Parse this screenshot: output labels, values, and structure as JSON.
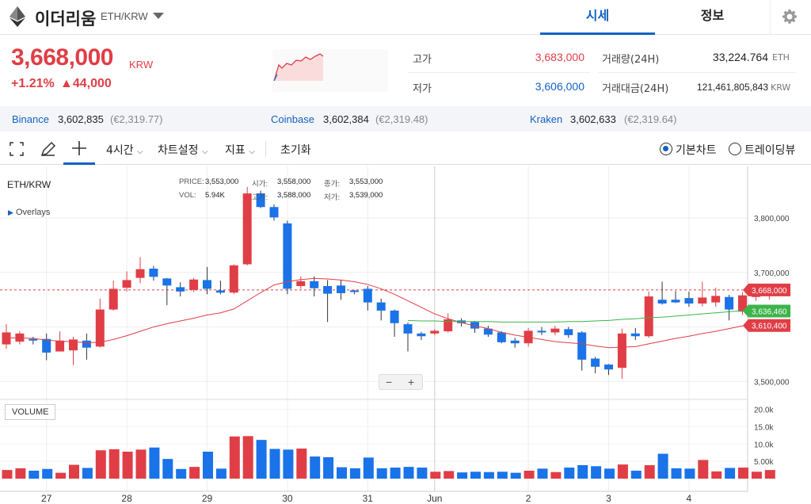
{
  "header": {
    "coin_name": "이더리움",
    "pair": "ETH/KRW",
    "tabs": [
      {
        "label": "시세"
      },
      {
        "label": "정보"
      }
    ]
  },
  "ticker": {
    "price": "3,668,000",
    "unit": "KRW",
    "change_pct": "+1.21%",
    "change_abs": "▲44,000",
    "high_label": "고가",
    "high": "3,683,000",
    "low_label": "저가",
    "low": "3,606,000",
    "volume_label": "거래량(24H)",
    "volume": "33,224.764",
    "volume_unit": "ETH",
    "amount_label": "거래대금(24H)",
    "amount": "121,461,805,843",
    "amount_unit": "KRW"
  },
  "exchanges": [
    {
      "name": "Binance",
      "price": "3,602,835",
      "eur": "(€2,319.77)"
    },
    {
      "name": "Coinbase",
      "price": "3,602,384",
      "eur": "(€2,319.48)"
    },
    {
      "name": "Kraken",
      "price": "3,602,633",
      "eur": "(€2,319.64)"
    }
  ],
  "toolbar": {
    "interval": "4시간",
    "chart_settings": "차트설정",
    "indicators": "지표",
    "reset": "초기화",
    "basic_chart": "기본차트",
    "tradingview": "트레이딩뷰"
  },
  "legend": {
    "symbol": "ETH/KRW",
    "overlays": "Overlays",
    "price_label": "PRICE:",
    "price": "3,553,000",
    "open_label": "시가:",
    "open": "3,558,000",
    "close_label": "종가:",
    "close": "3,553,000",
    "vol_label": "VOL:",
    "vol": "5.94K",
    "high_label": "고가:",
    "high": "3,588,000",
    "low_label": "저가:",
    "low": "3,539,000"
  },
  "price_tags": [
    {
      "value": "3,668,000",
      "color": "#e03e46"
    },
    {
      "value": "3,636,460",
      "color": "#3cb44b"
    },
    {
      "value": "3,610,400",
      "color": "#e03e46"
    }
  ],
  "volume_label": "VOLUME",
  "colors": {
    "up": "#e03e46",
    "down": "#1a73e8",
    "accent": "#1261c4",
    "ma_short": "#e03e46",
    "ma_long": "#3cb44b"
  },
  "chart_data": {
    "type": "candlestick",
    "ylim": [
      3470000,
      3880000
    ],
    "y_ticks": [
      3500000,
      3600000,
      3700000,
      3800000
    ],
    "y_tick_labels": [
      "3,500,000",
      "3,600,000",
      "3,700,000",
      "3,800,000"
    ],
    "vol_ylim": [
      0,
      22000
    ],
    "vol_ticks": [
      5000,
      10000,
      15000,
      20000
    ],
    "vol_tick_labels": [
      "5.00k",
      "10.0k",
      "15.0k",
      "20.0k"
    ],
    "x_labels": [
      "27",
      "28",
      "29",
      "30",
      "31",
      "Jun",
      "2",
      "3",
      "4"
    ],
    "x_label_index": [
      3,
      9,
      15,
      21,
      27,
      32,
      39,
      45,
      51
    ],
    "current_price": 3668000,
    "candles": [
      {
        "o": 3568000,
        "c": 3590000,
        "h": 3605000,
        "l": 3560000,
        "v": 2500
      },
      {
        "o": 3573000,
        "c": 3588000,
        "h": 3592000,
        "l": 3568000,
        "v": 3000
      },
      {
        "o": 3578000,
        "c": 3575000,
        "h": 3582000,
        "l": 3568000,
        "v": 2300
      },
      {
        "o": 3578000,
        "c": 3553000,
        "h": 3588000,
        "l": 3539000,
        "v": 2800
      },
      {
        "o": 3555000,
        "c": 3575000,
        "h": 3592000,
        "l": 3555000,
        "v": 1700
      },
      {
        "o": 3557000,
        "c": 3577000,
        "h": 3582000,
        "l": 3530000,
        "v": 4000
      },
      {
        "o": 3575000,
        "c": 3562000,
        "h": 3588000,
        "l": 3540000,
        "v": 3100
      },
      {
        "o": 3564000,
        "c": 3632000,
        "h": 3652000,
        "l": 3562000,
        "v": 8200
      },
      {
        "o": 3632000,
        "c": 3670000,
        "h": 3685000,
        "l": 3630000,
        "v": 8500
      },
      {
        "o": 3672000,
        "c": 3686000,
        "h": 3702000,
        "l": 3665000,
        "v": 7800
      },
      {
        "o": 3690000,
        "c": 3706000,
        "h": 3728000,
        "l": 3680000,
        "v": 8400
      },
      {
        "o": 3707000,
        "c": 3692000,
        "h": 3712000,
        "l": 3685000,
        "v": 9000
      },
      {
        "o": 3689000,
        "c": 3676000,
        "h": 3690000,
        "l": 3640000,
        "v": 5700
      },
      {
        "o": 3673000,
        "c": 3665000,
        "h": 3682000,
        "l": 3656000,
        "v": 2800
      },
      {
        "o": 3668000,
        "c": 3687000,
        "h": 3690000,
        "l": 3664000,
        "v": 3400
      },
      {
        "o": 3686000,
        "c": 3670000,
        "h": 3710000,
        "l": 3660000,
        "v": 7800
      },
      {
        "o": 3667000,
        "c": 3663000,
        "h": 3685000,
        "l": 3660000,
        "v": 2900
      },
      {
        "o": 3663000,
        "c": 3713000,
        "h": 3715000,
        "l": 3660000,
        "v": 12200
      },
      {
        "o": 3715000,
        "c": 3845000,
        "h": 3857000,
        "l": 3713000,
        "v": 12300
      },
      {
        "o": 3845000,
        "c": 3820000,
        "h": 3850000,
        "l": 3818000,
        "v": 11200
      },
      {
        "o": 3820000,
        "c": 3801000,
        "h": 3825000,
        "l": 3795000,
        "v": 8600
      },
      {
        "o": 3790000,
        "c": 3670000,
        "h": 3795000,
        "l": 3660000,
        "v": 8400
      },
      {
        "o": 3675000,
        "c": 3684000,
        "h": 3693000,
        "l": 3670000,
        "v": 8700
      },
      {
        "o": 3684000,
        "c": 3671000,
        "h": 3693000,
        "l": 3656000,
        "v": 6400
      },
      {
        "o": 3675000,
        "c": 3661000,
        "h": 3686000,
        "l": 3609000,
        "v": 6200
      },
      {
        "o": 3676000,
        "c": 3662000,
        "h": 3686000,
        "l": 3650000,
        "v": 3300
      },
      {
        "o": 3667000,
        "c": 3665000,
        "h": 3668000,
        "l": 3660000,
        "v": 3000
      },
      {
        "o": 3670000,
        "c": 3645000,
        "h": 3675000,
        "l": 3630000,
        "v": 6100
      },
      {
        "o": 3645000,
        "c": 3630000,
        "h": 3652000,
        "l": 3612000,
        "v": 3000
      },
      {
        "o": 3630000,
        "c": 3607000,
        "h": 3632000,
        "l": 3582000,
        "v": 3200
      },
      {
        "o": 3605000,
        "c": 3588000,
        "h": 3608000,
        "l": 3555000,
        "v": 3400
      },
      {
        "o": 3588000,
        "c": 3583000,
        "h": 3591000,
        "l": 3576000,
        "v": 3200
      },
      {
        "o": 3588000,
        "c": 3593000,
        "h": 3596000,
        "l": 3585000,
        "v": 2000
      },
      {
        "o": 3592000,
        "c": 3614000,
        "h": 3625000,
        "l": 3590000,
        "v": 2200
      },
      {
        "o": 3612000,
        "c": 3607000,
        "h": 3616000,
        "l": 3601000,
        "v": 1800
      },
      {
        "o": 3609000,
        "c": 3597000,
        "h": 3611000,
        "l": 3589000,
        "v": 2000
      },
      {
        "o": 3597000,
        "c": 3586000,
        "h": 3602000,
        "l": 3582000,
        "v": 1900
      },
      {
        "o": 3590000,
        "c": 3572000,
        "h": 3592000,
        "l": 3570000,
        "v": 2000
      },
      {
        "o": 3575000,
        "c": 3570000,
        "h": 3580000,
        "l": 3562000,
        "v": 1700
      },
      {
        "o": 3570000,
        "c": 3593000,
        "h": 3598000,
        "l": 3564000,
        "v": 2300
      },
      {
        "o": 3593000,
        "c": 3590000,
        "h": 3600000,
        "l": 3585000,
        "v": 2900
      },
      {
        "o": 3590000,
        "c": 3597000,
        "h": 3602000,
        "l": 3585000,
        "v": 1900
      },
      {
        "o": 3596000,
        "c": 3585000,
        "h": 3600000,
        "l": 3580000,
        "v": 3200
      },
      {
        "o": 3590000,
        "c": 3540000,
        "h": 3592000,
        "l": 3520000,
        "v": 3900
      },
      {
        "o": 3542000,
        "c": 3527000,
        "h": 3545000,
        "l": 3515000,
        "v": 3600
      },
      {
        "o": 3531000,
        "c": 3522000,
        "h": 3532000,
        "l": 3512000,
        "v": 2900
      },
      {
        "o": 3525000,
        "c": 3588000,
        "h": 3597000,
        "l": 3505000,
        "v": 4100
      },
      {
        "o": 3588000,
        "c": 3583000,
        "h": 3598000,
        "l": 3576000,
        "v": 2300
      },
      {
        "o": 3583000,
        "c": 3656000,
        "h": 3665000,
        "l": 3580000,
        "v": 3900
      },
      {
        "o": 3650000,
        "c": 3643000,
        "h": 3683000,
        "l": 3641000,
        "v": 7200
      },
      {
        "o": 3650000,
        "c": 3645000,
        "h": 3666000,
        "l": 3644000,
        "v": 3000
      },
      {
        "o": 3653000,
        "c": 3643000,
        "h": 3665000,
        "l": 3637000,
        "v": 2900
      },
      {
        "o": 3643000,
        "c": 3654000,
        "h": 3683000,
        "l": 3638000,
        "v": 5400
      },
      {
        "o": 3645000,
        "c": 3657000,
        "h": 3672000,
        "l": 3637000,
        "v": 2100
      },
      {
        "o": 3655000,
        "c": 3632000,
        "h": 3659000,
        "l": 3612000,
        "v": 3100
      },
      {
        "o": 3628000,
        "c": 3658000,
        "h": 3664000,
        "l": 3622000,
        "v": 3200
      },
      {
        "o": 3655000,
        "c": 3660000,
        "h": 3664000,
        "l": 3648000,
        "v": 2000
      },
      {
        "o": 3657000,
        "c": 3668000,
        "h": 3672000,
        "l": 3650000,
        "v": 2500
      }
    ],
    "ma_short": [
      3580000,
      3580000,
      3579000,
      3576000,
      3574000,
      3573000,
      3571000,
      3572000,
      3577000,
      3584000,
      3592000,
      3600000,
      3606000,
      3611000,
      3616000,
      3622000,
      3626000,
      3633000,
      3648000,
      3663000,
      3677000,
      3683000,
      3687000,
      3689000,
      3688000,
      3686000,
      3683000,
      3678000,
      3670000,
      3660000,
      3648000,
      3636000,
      3624000,
      3615000,
      3608000,
      3602000,
      3597000,
      3590000,
      3585000,
      3581000,
      3577000,
      3573000,
      3571000,
      3569000,
      3565000,
      3562000,
      3563000,
      3564000,
      3569000,
      3574000,
      3579000,
      3583000,
      3588000,
      3592000,
      3597000,
      3602000,
      3606000,
      3610000
    ],
    "ma_long_start": 30,
    "ma_long": [
      3612000,
      3611000,
      3611000,
      3610000,
      3610000,
      3610000,
      3610000,
      3609000,
      3609000,
      3609000,
      3609000,
      3609000,
      3610000,
      3610000,
      3611000,
      3612000,
      3614000,
      3615000,
      3617000,
      3618000,
      3620000,
      3622000,
      3624000,
      3626000,
      3628000,
      3630000,
      3632000,
      3635000
    ]
  }
}
